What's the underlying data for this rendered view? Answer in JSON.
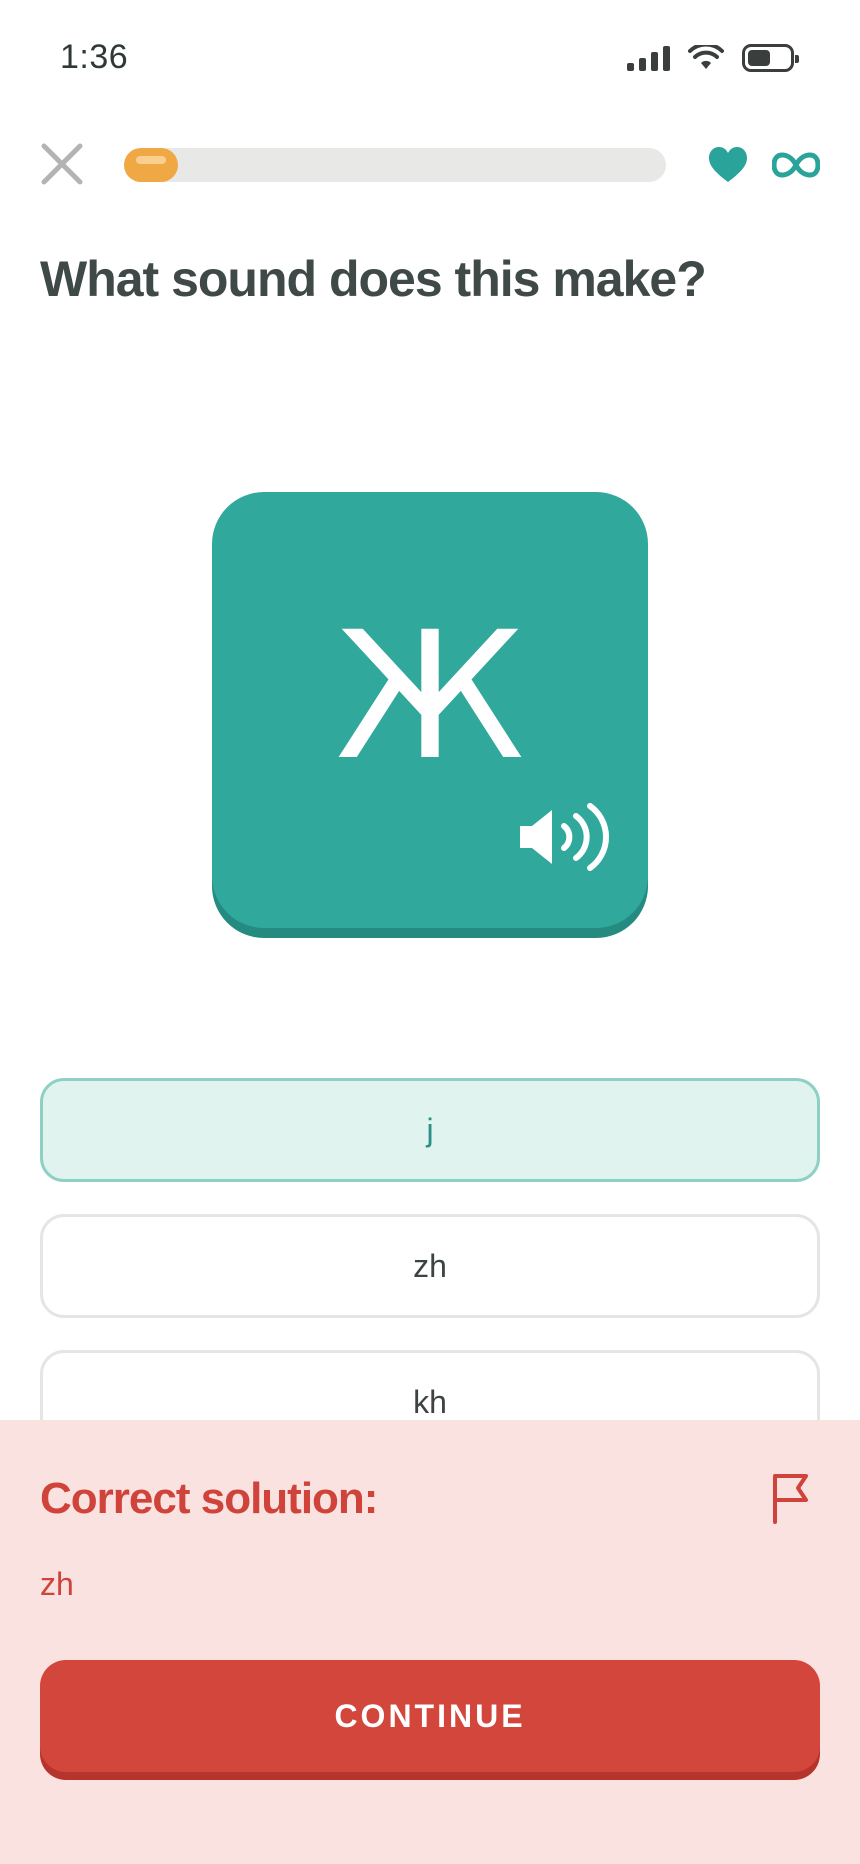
{
  "status_bar": {
    "time": "1:36",
    "icons": [
      "cellular-signal-icon",
      "wifi-icon",
      "battery-icon"
    ]
  },
  "header": {
    "close_icon": "close-icon",
    "progress": 0.1,
    "hearts_icon": "heart-icon",
    "hearts_count_icon": "infinity-icon"
  },
  "prompt": {
    "title": "What sound does this make?"
  },
  "card": {
    "letter": "Ж",
    "audio_icon": "speaker-icon"
  },
  "options": [
    {
      "label": "j",
      "selected": true
    },
    {
      "label": "zh",
      "selected": false
    },
    {
      "label": "kh",
      "selected": false
    }
  ],
  "feedback": {
    "title": "Correct solution:",
    "solution": "zh",
    "report_icon": "flag-icon",
    "continue_label": "CONTINUE"
  },
  "colors": {
    "accent_teal": "#31a89c",
    "progress_orange": "#f0a844",
    "error_red": "#d2463c",
    "feedback_bg": "#f9e2e0"
  }
}
